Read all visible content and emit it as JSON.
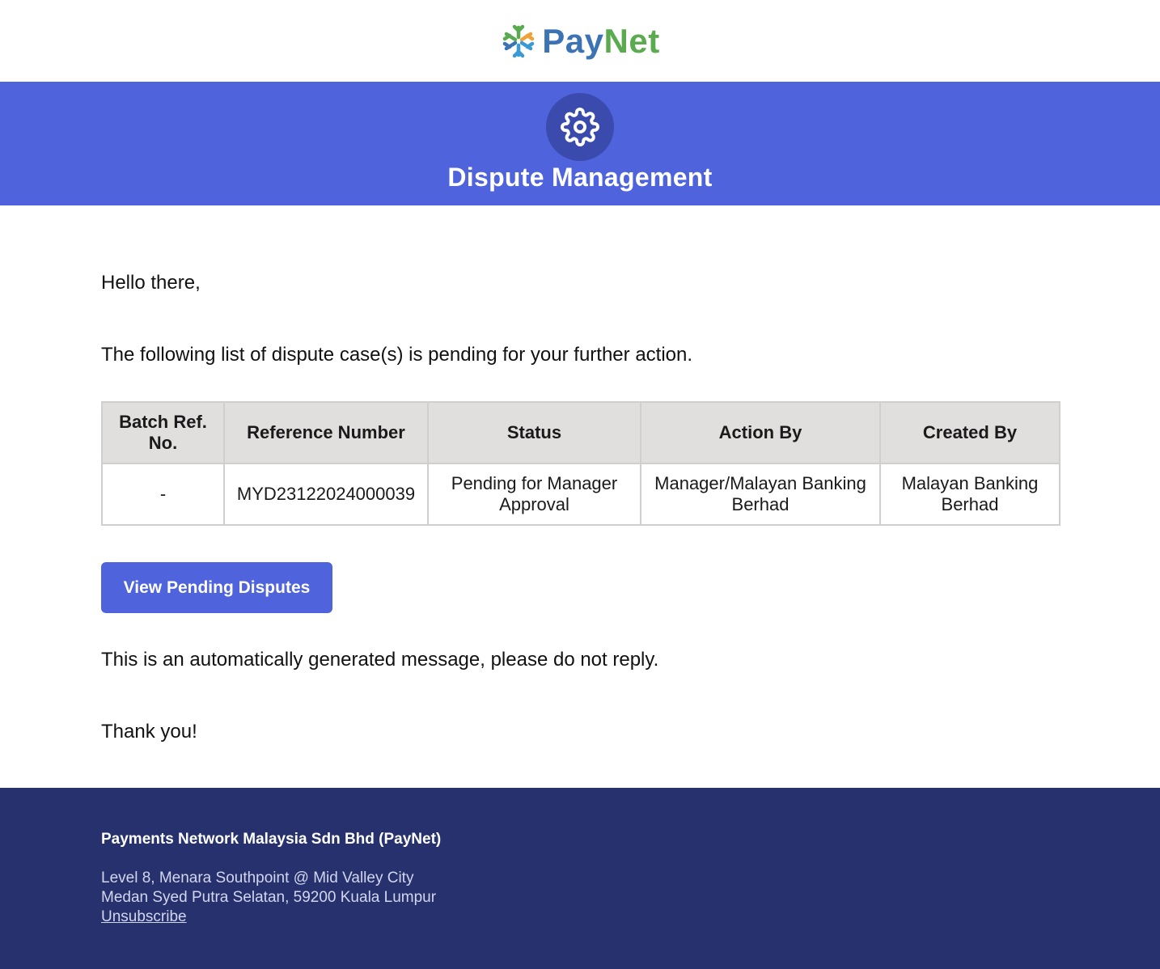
{
  "header": {
    "logo": {
      "icon": "paynet-snowflake-logo-icon",
      "text_pay": "Pay",
      "text_net": "Net",
      "colors": {
        "pay": "#3b73b5",
        "net": "#5aab4f"
      }
    }
  },
  "banner": {
    "icon": "gear-icon",
    "title": "Dispute Management",
    "colors": {
      "background": "#4f63dd",
      "icon_circle": "#3a4aad"
    }
  },
  "body": {
    "greeting": "Hello there,",
    "intro": "The following list of dispute case(s) is pending for your further action.",
    "table": {
      "headers": [
        "Batch Ref. No.",
        "Reference Number",
        "Status",
        "Action By",
        "Created By"
      ],
      "rows": [
        [
          "-",
          "MYD23122024000039",
          "Pending for Manager Approval",
          "Manager/Malayan Banking Berhad",
          "Malayan Banking Berhad"
        ]
      ]
    },
    "cta_label": "View Pending Disputes",
    "auto_message": "This is an automatically generated message, please do not reply.",
    "closing": "Thank you!"
  },
  "footer": {
    "company": "Payments Network Malaysia Sdn Bhd (PayNet)",
    "address_line1": "Level 8, Menara Southpoint @ Mid Valley City",
    "address_line2": "Medan Syed Putra Selatan, 59200 Kuala Lumpur",
    "unsubscribe": "Unsubscribe",
    "colors": {
      "background": "#26316e"
    }
  }
}
